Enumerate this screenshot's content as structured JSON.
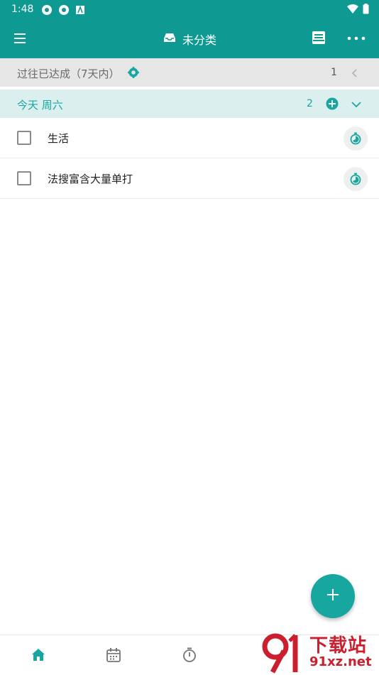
{
  "status_bar": {
    "time": "1:48"
  },
  "app_bar": {
    "title": "未分类"
  },
  "past_section": {
    "label": "过往已达成（7天内）",
    "count": "1"
  },
  "today_section": {
    "label": "今天 周六",
    "count": "2"
  },
  "tasks": [
    {
      "name": "生活"
    },
    {
      "name": "法搜富含大量单打"
    }
  ],
  "watermark": {
    "site_name": "下载站",
    "domain": "91xz.net"
  },
  "colors": {
    "primary": "#0e9a93",
    "accent": "#17a6a0",
    "past_bg": "#e6e6e6",
    "today_bg": "#dcefef"
  },
  "icons": {
    "menu": "menu-icon",
    "inbox": "inbox-icon",
    "archive": "archive-icon",
    "more": "more-icon",
    "gear": "gear-icon",
    "chevron_left": "chevron-left-icon",
    "add_circle": "add-circle-icon",
    "chevron_down": "chevron-down-icon",
    "timer": "timer-icon",
    "plus": "plus-icon",
    "home": "home-icon",
    "calendar": "calendar-icon",
    "stopwatch": "stopwatch-icon"
  }
}
